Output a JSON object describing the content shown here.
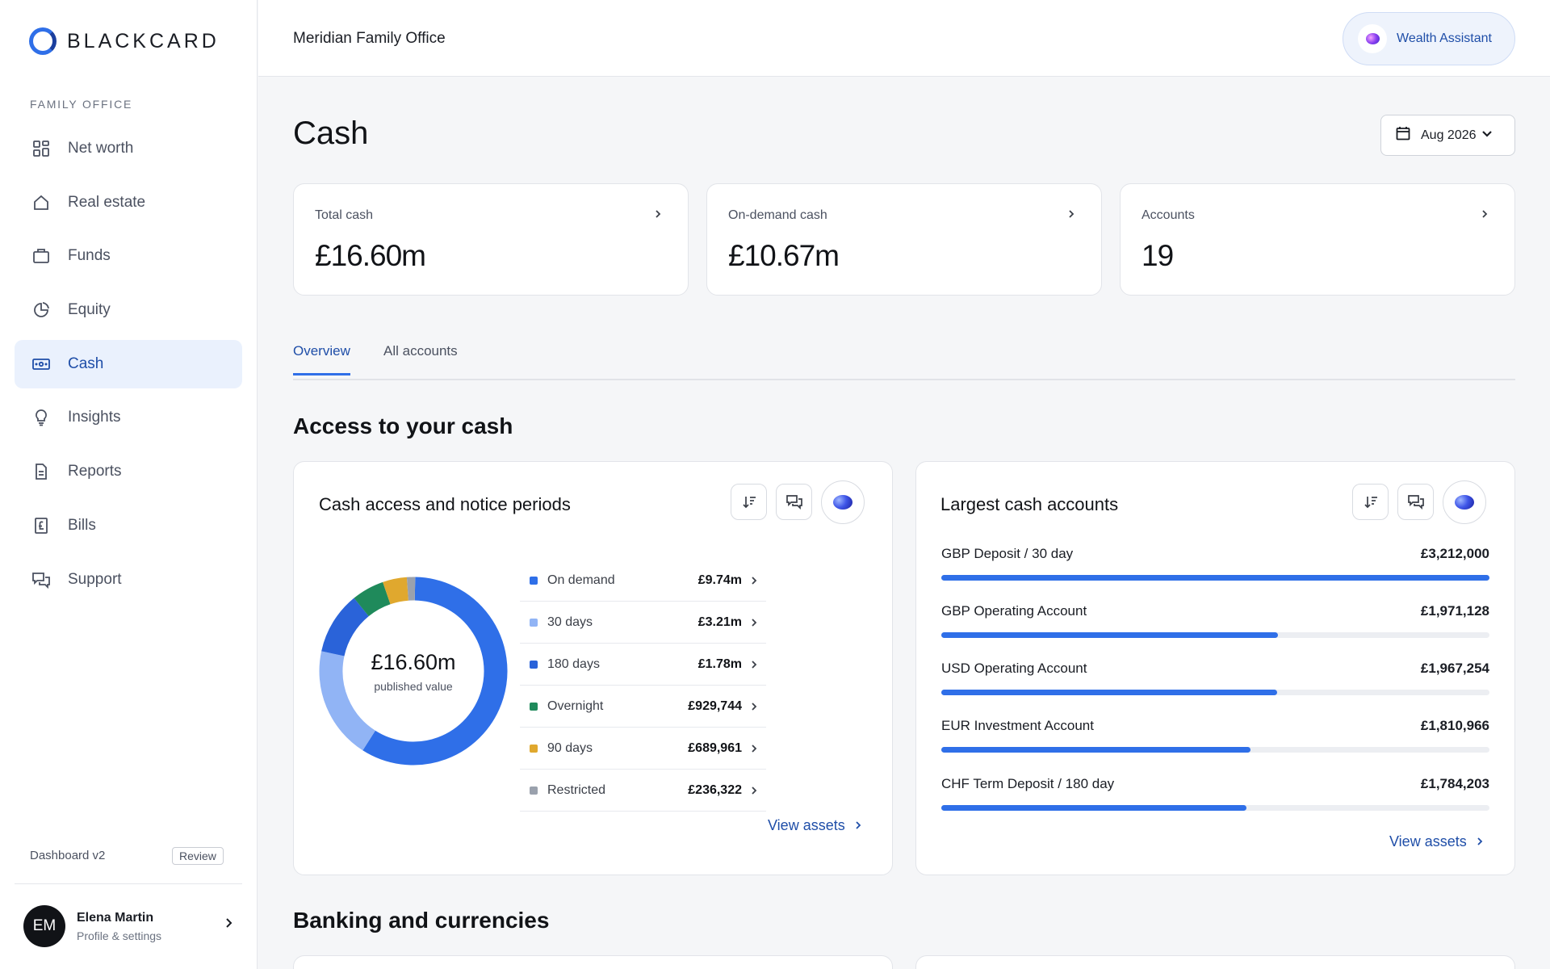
{
  "brand": {
    "name": "BLACKCARD"
  },
  "sidebar": {
    "section_label": "FAMILY OFFICE",
    "items": [
      {
        "label": "Net worth",
        "icon": "grid-icon"
      },
      {
        "label": "Real estate",
        "icon": "home-icon"
      },
      {
        "label": "Funds",
        "icon": "briefcase-icon"
      },
      {
        "label": "Equity",
        "icon": "pie-chart-icon"
      },
      {
        "label": "Cash",
        "icon": "banknote-icon",
        "active": true
      },
      {
        "label": "Insights",
        "icon": "lightbulb-icon"
      },
      {
        "label": "Reports",
        "icon": "document-icon"
      },
      {
        "label": "Bills",
        "icon": "pound-receipt-icon"
      },
      {
        "label": "Support",
        "icon": "chat-bubbles-icon"
      }
    ],
    "version_label": "Dashboard v2",
    "review_label": "Review",
    "user": {
      "initials": "EM",
      "name": "Elena Martin",
      "subtitle": "Profile & settings"
    }
  },
  "header": {
    "org_name": "Meridian Family Office",
    "assistant_label": "Wealth Assistant"
  },
  "page": {
    "title": "Cash",
    "date_label": "Aug 2026"
  },
  "stats": [
    {
      "label": "Total cash",
      "value": "£16.60m"
    },
    {
      "label": "On-demand cash",
      "value": "£10.67m"
    },
    {
      "label": "Accounts",
      "value": "19"
    }
  ],
  "tabs": [
    {
      "label": "Overview",
      "active": true
    },
    {
      "label": "All accounts"
    }
  ],
  "sections": {
    "access_title": "Access to your cash",
    "banking_title": "Banking and currencies"
  },
  "notice_panel": {
    "title": "Cash access and notice periods",
    "center_value": "£16.60m",
    "center_sub": "published value",
    "link_label": "View assets",
    "rows": [
      {
        "label": "On demand",
        "value": "£9.74m",
        "amount": 9.74,
        "color": "#2f6fe8"
      },
      {
        "label": "30 days",
        "value": "£3.21m",
        "amount": 3.21,
        "color": "#91b4f5"
      },
      {
        "label": "180 days",
        "value": "£1.78m",
        "amount": 1.78,
        "color": "#2a63d9"
      },
      {
        "label": "Overnight",
        "value": "£929,744",
        "amount": 0.929744,
        "color": "#1f8a5b"
      },
      {
        "label": "90 days",
        "value": "£689,961",
        "amount": 0.689961,
        "color": "#e0a82e"
      },
      {
        "label": "Restricted",
        "value": "£236,322",
        "amount": 0.236322,
        "color": "#9aa1ad"
      }
    ]
  },
  "largest_panel": {
    "title": "Largest cash accounts",
    "link_label": "View assets",
    "accounts": [
      {
        "name": "GBP Deposit / 30 day",
        "value": "£3,212,000",
        "share": 1.0
      },
      {
        "name": "GBP Operating Account",
        "value": "£1,971,128",
        "share": 0.614
      },
      {
        "name": "USD Operating Account",
        "value": "£1,967,254",
        "share": 0.613
      },
      {
        "name": "EUR Investment Account",
        "value": "£1,810,966",
        "share": 0.564
      },
      {
        "name": "CHF Term Deposit / 180 day",
        "value": "£1,784,203",
        "share": 0.556
      }
    ]
  }
}
